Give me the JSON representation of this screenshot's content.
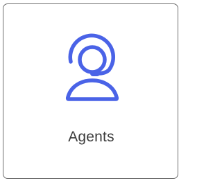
{
  "tile": {
    "label": "Agents",
    "icon": "headset-agent-icon"
  },
  "colors": {
    "accent": "#4a63e7",
    "border": "#6e6e6e",
    "text": "#3b3b3b"
  }
}
